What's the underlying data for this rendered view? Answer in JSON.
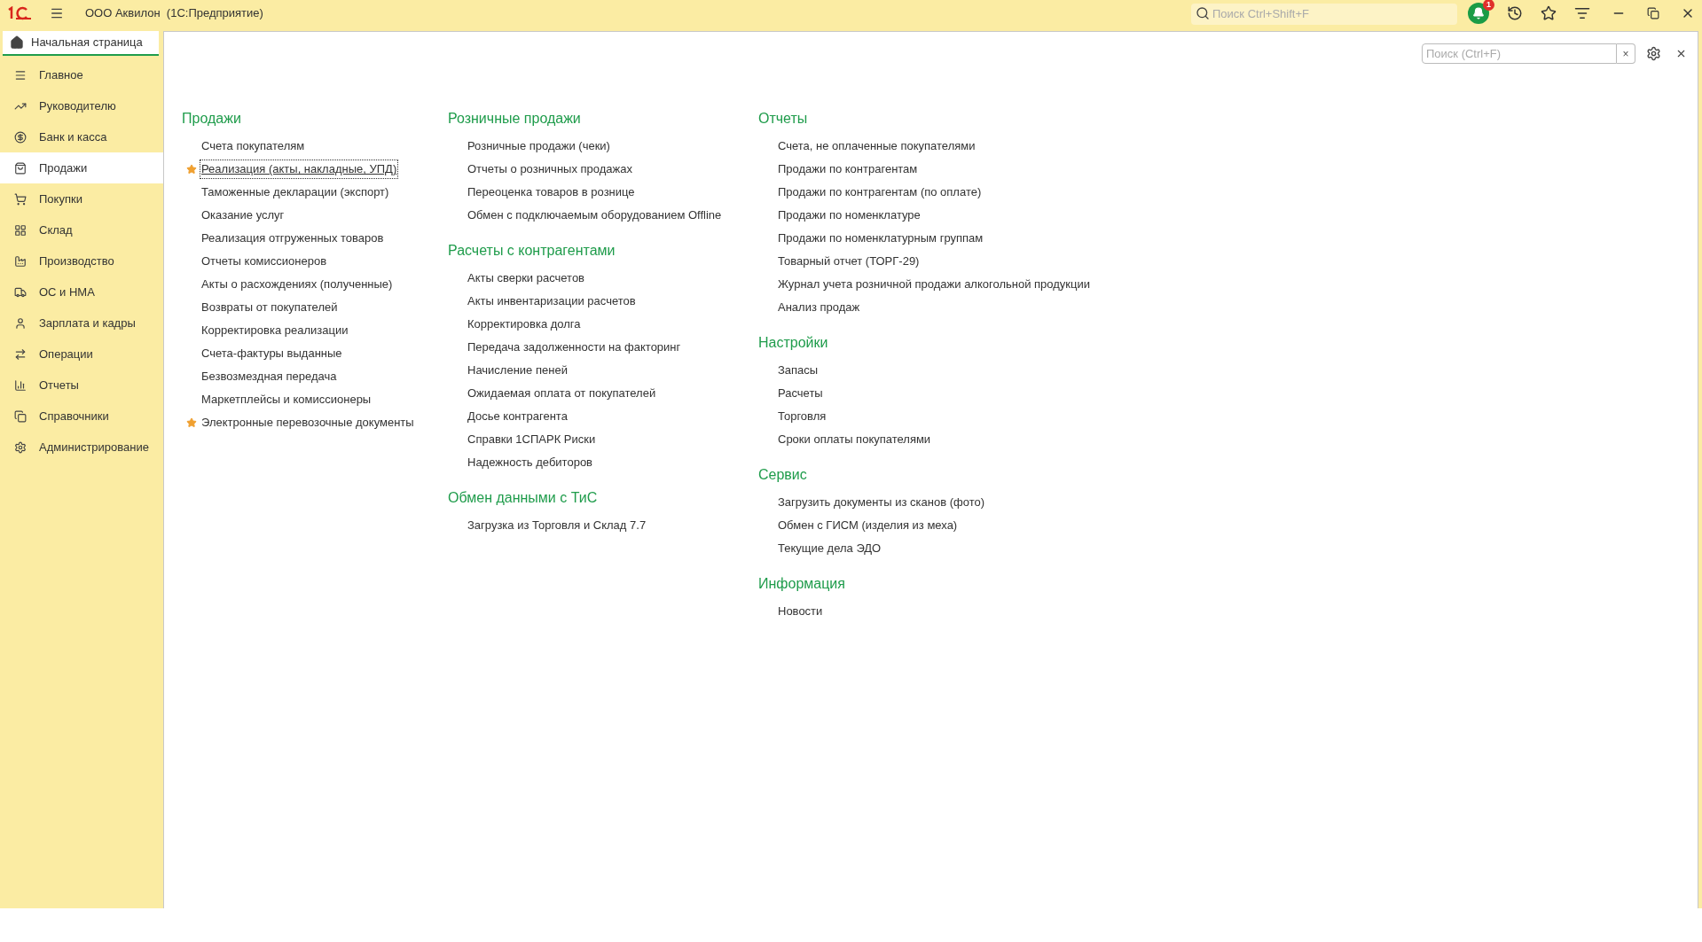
{
  "titlebar": {
    "title": "ООО Аквилон  (1С:Предприятие)",
    "search": {
      "placeholder": "Поиск Ctrl+Shift+F"
    },
    "notifications": {
      "count": "1"
    }
  },
  "home_tab": {
    "label": "Начальная страница",
    "selected": true
  },
  "sidebar": {
    "items": [
      {
        "label": "Главное",
        "selected": false
      },
      {
        "label": "Руководителю",
        "selected": false
      },
      {
        "label": "Банк и касса",
        "selected": false
      },
      {
        "label": "Продажи",
        "selected": true
      },
      {
        "label": "Покупки",
        "selected": false
      },
      {
        "label": "Склад",
        "selected": false
      },
      {
        "label": "Производство",
        "selected": false
      },
      {
        "label": "ОС и НМА",
        "selected": false
      },
      {
        "label": "Зарплата и кадры",
        "selected": false
      },
      {
        "label": "Операции",
        "selected": false
      },
      {
        "label": "Отчеты",
        "selected": false
      },
      {
        "label": "Справочники",
        "selected": false
      },
      {
        "label": "Администрирование",
        "selected": false
      }
    ]
  },
  "panel": {
    "search": {
      "placeholder": "Поиск (Ctrl+F)"
    },
    "clear": "×"
  },
  "columns": [
    {
      "sections": [
        {
          "title": "Продажи",
          "items": [
            {
              "label": "Счета покупателям",
              "favorite": false,
              "focused": false
            },
            {
              "label": "Реализация (акты, накладные, УПД)",
              "favorite": true,
              "focused": true
            },
            {
              "label": "Таможенные декларации (экспорт)",
              "favorite": false,
              "focused": false
            },
            {
              "label": "Оказание услуг",
              "favorite": false,
              "focused": false
            },
            {
              "label": "Реализация отгруженных товаров",
              "favorite": false,
              "focused": false
            },
            {
              "label": "Отчеты комиссионеров",
              "favorite": false,
              "focused": false
            },
            {
              "label": "Акты о расхождениях (полученные)",
              "favorite": false,
              "focused": false
            },
            {
              "label": "Возвраты от покупателей",
              "favorite": false,
              "focused": false
            },
            {
              "label": "Корректировка реализации",
              "favorite": false,
              "focused": false
            },
            {
              "label": "Счета-фактуры выданные",
              "favorite": false,
              "focused": false
            },
            {
              "label": "Безвозмездная передача",
              "favorite": false,
              "focused": false
            },
            {
              "label": "Маркетплейсы и комиссионеры",
              "favorite": false,
              "focused": false
            },
            {
              "label": "Электронные перевозочные документы",
              "favorite": true,
              "focused": false
            }
          ]
        }
      ]
    },
    {
      "sections": [
        {
          "title": "Розничные продажи",
          "items": [
            {
              "label": "Розничные продажи (чеки)",
              "favorite": false,
              "focused": false
            },
            {
              "label": "Отчеты о розничных продажах",
              "favorite": false,
              "focused": false
            },
            {
              "label": "Переоценка товаров в рознице",
              "favorite": false,
              "focused": false
            },
            {
              "label": "Обмен с подключаемым оборудованием Offline",
              "favorite": false,
              "focused": false
            }
          ]
        },
        {
          "title": "Расчеты с контрагентами",
          "items": [
            {
              "label": "Акты сверки расчетов",
              "favorite": false,
              "focused": false
            },
            {
              "label": "Акты инвентаризации расчетов",
              "favorite": false,
              "focused": false
            },
            {
              "label": "Корректировка долга",
              "favorite": false,
              "focused": false
            },
            {
              "label": "Передача задолженности на факторинг",
              "favorite": false,
              "focused": false
            },
            {
              "label": "Начисление пеней",
              "favorite": false,
              "focused": false
            },
            {
              "label": "Ожидаемая оплата от покупателей",
              "favorite": false,
              "focused": false
            },
            {
              "label": "Досье контрагента",
              "favorite": false,
              "focused": false
            },
            {
              "label": "Справки 1СПАРК Риски",
              "favorite": false,
              "focused": false
            },
            {
              "label": "Надежность дебиторов",
              "favorite": false,
              "focused": false
            }
          ]
        },
        {
          "title": "Обмен данными с ТиС",
          "items": [
            {
              "label": "Загрузка из Торговля и Склад 7.7",
              "favorite": false,
              "focused": false
            }
          ]
        }
      ]
    },
    {
      "sections": [
        {
          "title": "Отчеты",
          "items": [
            {
              "label": "Счета, не оплаченные покупателями",
              "favorite": false,
              "focused": false
            },
            {
              "label": "Продажи по контрагентам",
              "favorite": false,
              "focused": false
            },
            {
              "label": "Продажи по контрагентам (по оплате)",
              "favorite": false,
              "focused": false
            },
            {
              "label": "Продажи по номенклатуре",
              "favorite": false,
              "focused": false
            },
            {
              "label": "Продажи по номенклатурным группам",
              "favorite": false,
              "focused": false
            },
            {
              "label": "Товарный отчет (ТОРГ-29)",
              "favorite": false,
              "focused": false
            },
            {
              "label": "Журнал учета розничной продажи алкогольной продукции",
              "favorite": false,
              "focused": false
            },
            {
              "label": "Анализ продаж",
              "favorite": false,
              "focused": false
            }
          ]
        },
        {
          "title": "Настройки",
          "items": [
            {
              "label": "Запасы",
              "favorite": false,
              "focused": false
            },
            {
              "label": "Расчеты",
              "favorite": false,
              "focused": false
            },
            {
              "label": "Торговля",
              "favorite": false,
              "focused": false
            },
            {
              "label": "Сроки оплаты покупателями",
              "favorite": false,
              "focused": false
            }
          ]
        },
        {
          "title": "Сервис",
          "items": [
            {
              "label": "Загрузить документы из сканов (фото)",
              "favorite": false,
              "focused": false
            },
            {
              "label": "Обмен с ГИСМ (изделия из меха)",
              "favorite": false,
              "focused": false
            },
            {
              "label": "Текущие дела ЭДО",
              "favorite": false,
              "focused": false
            }
          ]
        },
        {
          "title": "Информация",
          "items": [
            {
              "label": "Новости",
              "favorite": false,
              "focused": false
            }
          ]
        }
      ]
    }
  ]
}
